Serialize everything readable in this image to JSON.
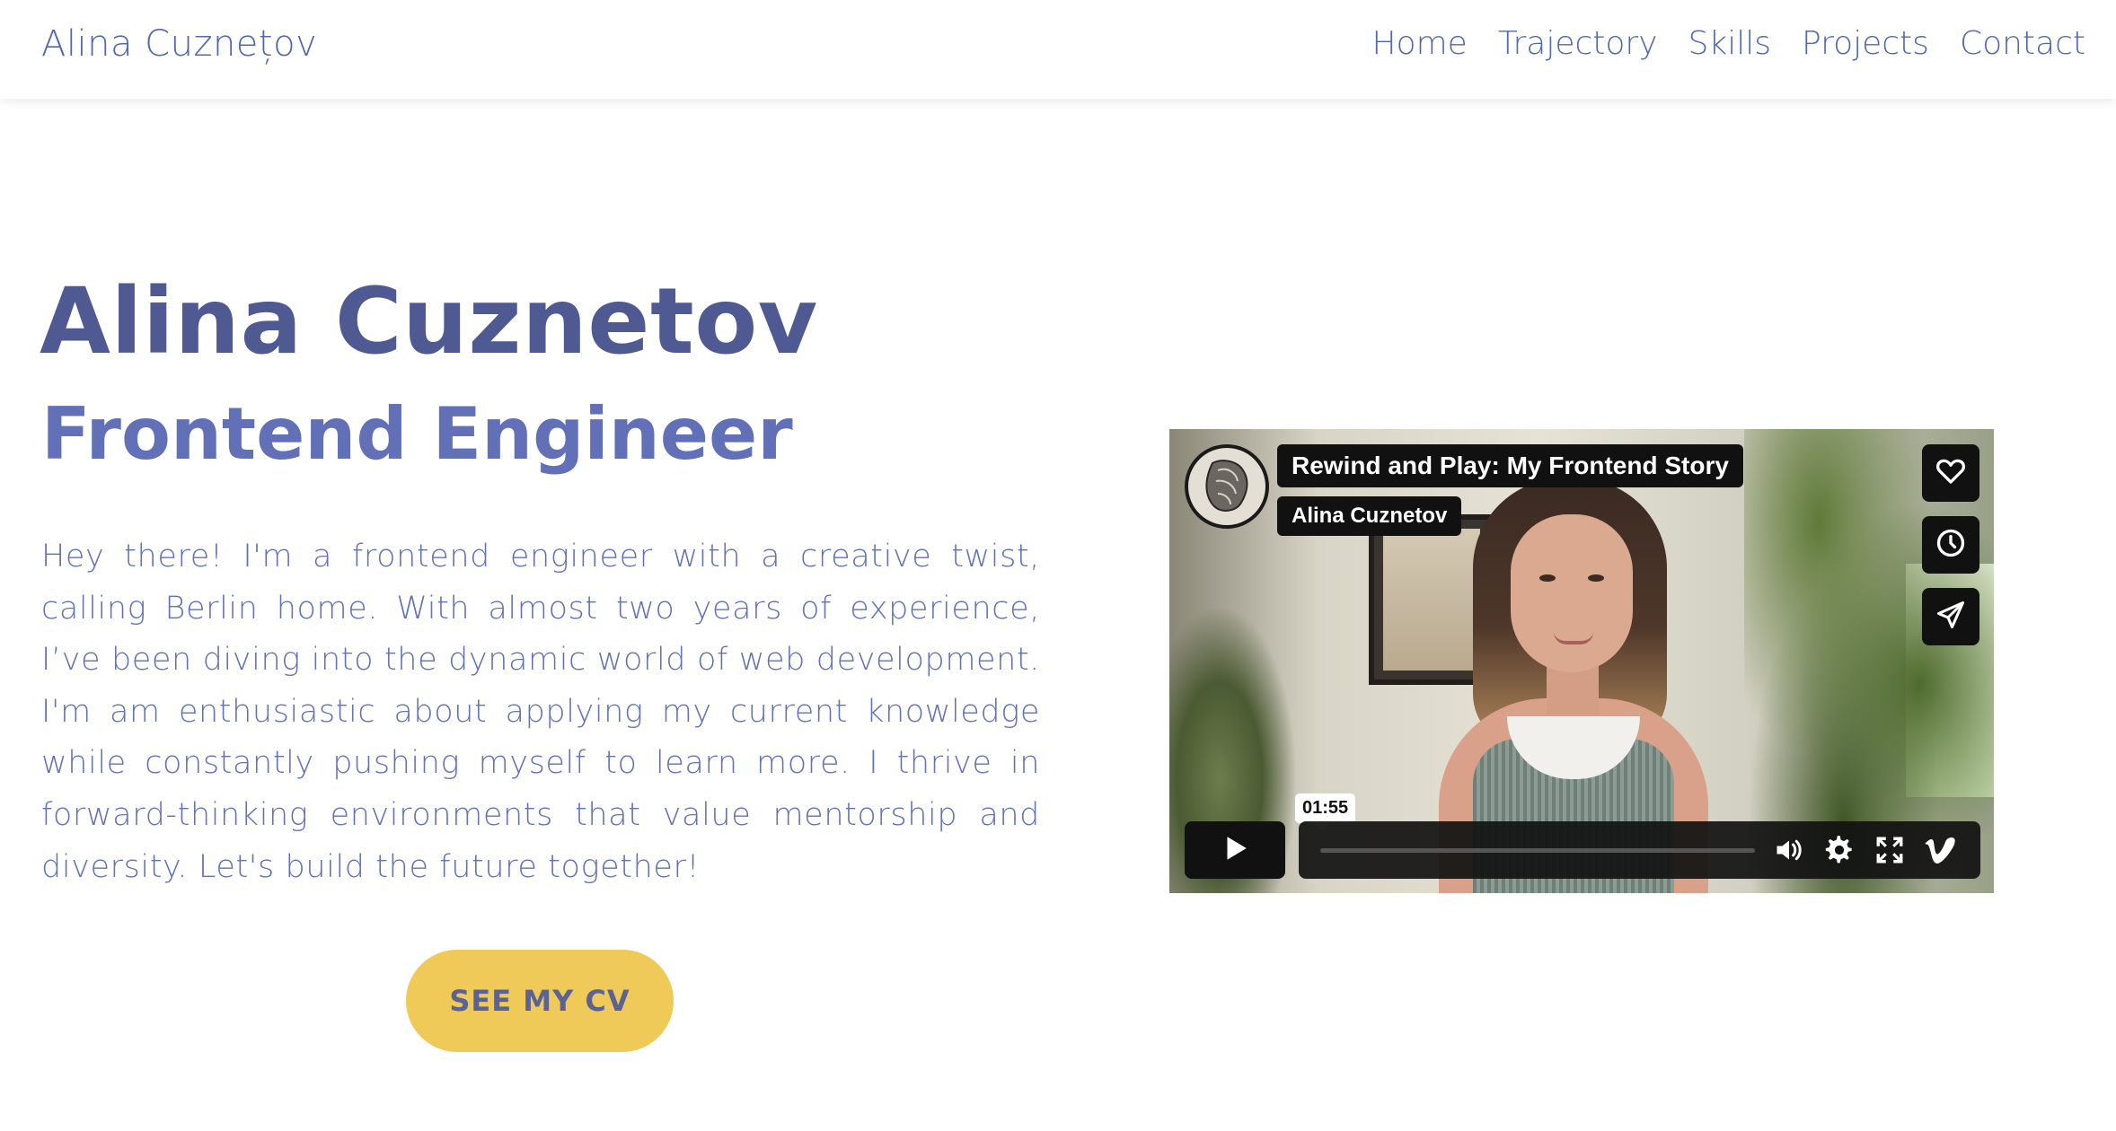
{
  "nav": {
    "brand": "Alina Cuznețov",
    "links": [
      "Home",
      "Trajectory",
      "Skills",
      "Projects",
      "Contact"
    ]
  },
  "hero": {
    "name": "Alina Cuznetov",
    "role": "Frontend Engineer",
    "bio": "Hey there! I'm a frontend engineer with a creative twist, calling Berlin home. With almost two years of experience, I’ve been diving into the dynamic world of web development. I'm am enthusiastic about applying my current knowledge while constantly pushing myself to learn more. I thrive in forward-thinking environments that value mentorship and diversity. Let's build the future together!",
    "cv_button": "SEE MY CV"
  },
  "video": {
    "title": "Rewind and Play: My Frontend Story",
    "author": "Alina Cuznetov",
    "time": "01:55",
    "side_icons": [
      "heart-icon",
      "clock-icon",
      "send-icon"
    ],
    "control_icons": [
      "play-icon",
      "volume-icon",
      "settings-icon",
      "fullscreen-icon",
      "vimeo-logo-icon"
    ]
  },
  "colors": {
    "primary_text": "#5068b0",
    "heading": "#4f5a92",
    "subheading": "#6270b8",
    "button_bg": "#f0ca58",
    "player_dark": "#111111"
  }
}
